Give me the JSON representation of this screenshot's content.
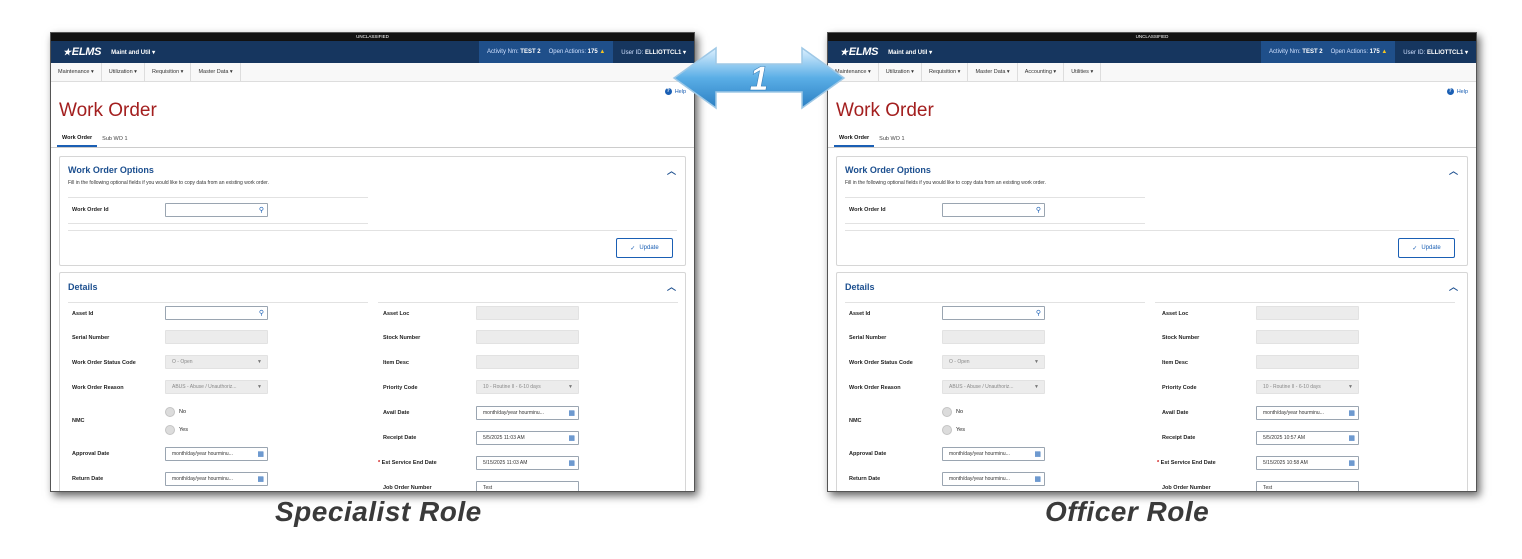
{
  "classification": "UNCLASSIFIED",
  "logo_text": "ELMS",
  "app_switch": "Maint and Util ▾",
  "activity_label": "Activity Nm:",
  "activity_value": "TEST 2",
  "open_actions_label": "Open Actions:",
  "open_actions_value": "175",
  "user_label": "User ID:",
  "user_value": "ELLIOTTCL1 ▾",
  "help": "Help",
  "page_title": "Work Order",
  "tabs": [
    "Work Order",
    "Sub WO 1"
  ],
  "options_panel": {
    "title": "Work Order Options",
    "desc": "Fill in the following optional fields if you would like to copy data from an existing work order.",
    "wo_id_label": "Work Order Id",
    "update_label": "Update"
  },
  "details": {
    "title": "Details",
    "asset_id": "Asset Id",
    "serial_number": "Serial Number",
    "status_code": "Work Order Status Code",
    "status_value": "O - Open",
    "reason": "Work Order Reason",
    "reason_value": "ABUS - Abuse / Unauthoriz...",
    "nmc": "NMC",
    "no": "No",
    "yes": "Yes",
    "approval_date": "Approval Date",
    "return_date": "Return Date",
    "date_placeholder": "month/day/year hourminu...",
    "asset_loc": "Asset Loc",
    "stock_number": "Stock Number",
    "item_desc": "Item Desc",
    "priority_code": "Priority Code",
    "priority_value": "10 - Routine II - 6-10 days",
    "avail_date": "Avail Date",
    "receipt_date": "Receipt Date",
    "est_end": "Est Service End Date",
    "job_order": "Job Order Number",
    "job_value": "Test"
  },
  "left": {
    "menu": [
      "Maintenance ▾",
      "Utilization ▾",
      "Requisition ▾",
      "Master Data ▾"
    ],
    "receipt_value": "5/5/2025 11:03 AM",
    "est_end_value": "5/15/2025 11:03 AM"
  },
  "right": {
    "menu": [
      "Maintenance ▾",
      "Utilization ▾",
      "Requisition ▾",
      "Master Data ▾",
      "Accounting ▾",
      "Utilities ▾"
    ],
    "receipt_value": "5/5/2025 10:57 AM",
    "est_end_value": "5/15/2025 10:58 AM"
  },
  "arrow_number": "1",
  "caption_left": "Specialist Role",
  "caption_right": "Officer Role",
  "colors": {
    "header": "#16365f",
    "activity": "#1f4f8a",
    "title": "#a31f1f",
    "accent": "#1c4f8f"
  }
}
